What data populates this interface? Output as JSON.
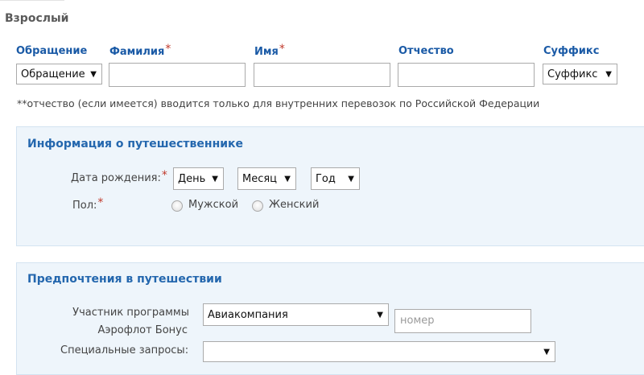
{
  "section": {
    "title": "Взрослый"
  },
  "name_fields": {
    "salutation_label": "Обращение",
    "salutation_value": "Обращение",
    "lastname_label": "Фамилия",
    "firstname_label": "Имя",
    "middlename_label": "Отчество",
    "suffix_label": "Суффикс",
    "suffix_value": "Суффикс",
    "required_mark": "*"
  },
  "note": "**отчество (если имеется) вводится только для внутренних перевозок по Российской Федерации",
  "traveler_info": {
    "title": "Информация о путешественнике",
    "dob_label": "Дата рождения:",
    "day": "День",
    "month": "Месяц",
    "year": "Год",
    "gender_label": "Пол:",
    "male": "Мужской",
    "female": "Женский"
  },
  "preferences": {
    "title": "Предпочтения в путешествии",
    "program_label_line1": "Участник программы",
    "program_label_line2": "Аэрофлот Бонус",
    "airline_value": "Авиакомпания",
    "number_placeholder": "номер",
    "special_requests_label": "Специальные запросы:",
    "special_requests_value": ""
  },
  "icons": {
    "dropdown": "caret-down-icon"
  }
}
